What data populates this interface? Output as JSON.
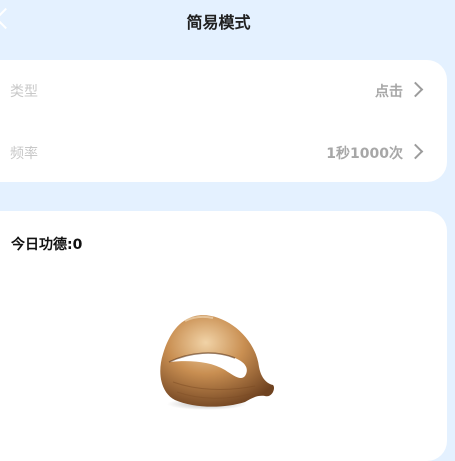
{
  "header": {
    "title": "简易模式"
  },
  "settings": {
    "rows": [
      {
        "label": "类型",
        "value": "点击"
      },
      {
        "label": "频率",
        "value": "1秒1000次"
      }
    ]
  },
  "main": {
    "merit_label": "今日功德:0"
  },
  "icons": {
    "back": "chevron-left-icon",
    "row_arrow": "chevron-right-icon",
    "fish": "wooden-fish-icon"
  },
  "colors": {
    "background": "#e4f1ff",
    "card": "#ffffff",
    "wood": "#c48a4b"
  }
}
